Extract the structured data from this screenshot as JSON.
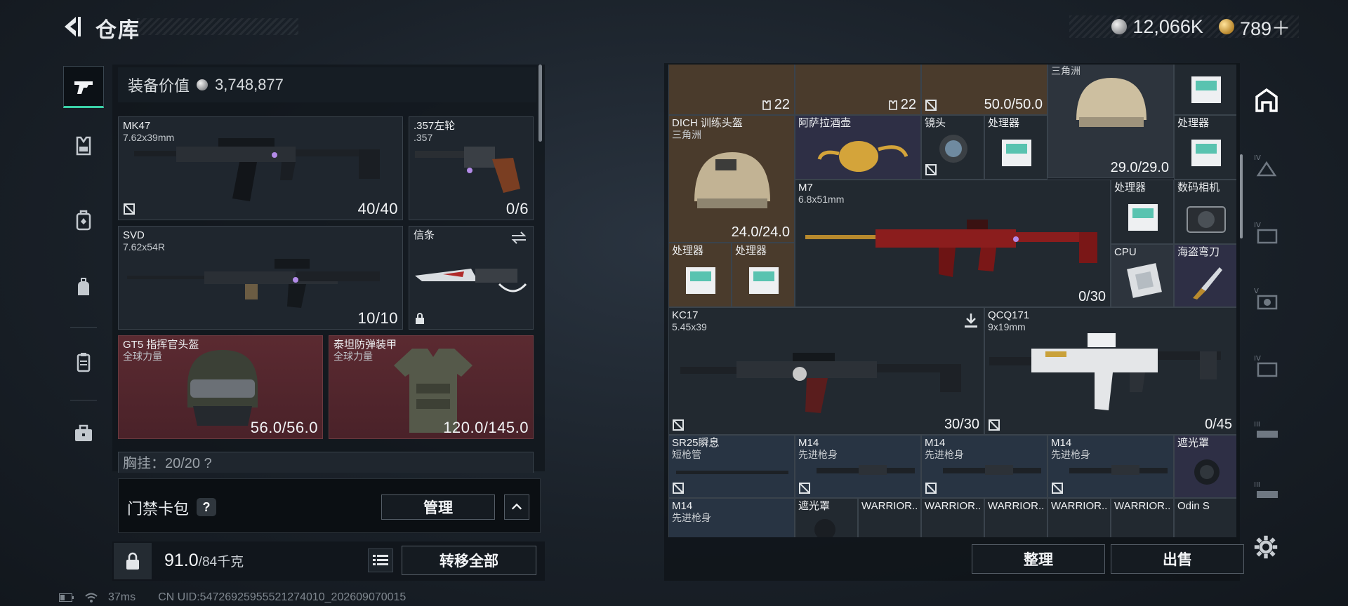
{
  "header": {
    "title": "仓库"
  },
  "currency": {
    "silver": "12,066K",
    "gold": "789＋"
  },
  "equipment": {
    "value_label": "装备价值",
    "value": "3,748,877",
    "slots": [
      {
        "name": "MK47",
        "caliber": "7.62x39mm",
        "ammo": "40/40"
      },
      {
        "name": ".357左轮",
        "caliber": ".357",
        "ammo": "0/6"
      },
      {
        "name": "SVD",
        "caliber": "7.62x54R",
        "ammo": "10/10"
      },
      {
        "name": "信条"
      },
      {
        "name": "GT5 指挥官头盔",
        "sub": "全球力量",
        "durability": "56.0/56.0"
      },
      {
        "name": "泰坦防弹装甲",
        "sub": "全球力量",
        "durability": "120.0/145.0"
      }
    ],
    "partial_row": "胸挂：20/20 ?"
  },
  "access_card": {
    "label": "门禁卡包",
    "help": "?",
    "manage_button": "管理",
    "collapse_icon": "chevron-up-icon"
  },
  "footer_left": {
    "weight": "91.0",
    "weight_max": "/84千克",
    "transfer_all": "转移全部"
  },
  "status_bar": {
    "ping": "37ms",
    "uid": "CN UID:5472692595552127401­0_202609070015"
  },
  "grid": {
    "row0": {
      "a": "22",
      "b": "22",
      "c": "50.0/50.0",
      "top_label": "三角洲",
      "d": "29.0/29.0"
    },
    "items": {
      "dich_name": "DICH 训练头盔",
      "dich_sub": "三角洲",
      "dich_dur": "24.0/24.0",
      "jug": "阿萨拉酒壶",
      "lens": "镜头",
      "proc": "处理器",
      "m7_name": "M7",
      "m7_cal": "6.8x51mm",
      "m7_ammo": "0/30",
      "camera": "数码相机",
      "cpu": "CPU",
      "knife": "海盗弯刀",
      "kc17_name": "KC17",
      "kc17_cal": "5.45x39",
      "kc17_ammo": "30/30",
      "qcq_name": "QCQ171",
      "qcq_cal": "9x19mm",
      "qcq_ammo": "0/45",
      "sr25_name": "SR25瞬息",
      "sr25_sub": "短枪管",
      "m14": "M14",
      "m14_sub": "先进枪身",
      "shade": "遮光罩",
      "warrior": "WARRIOR..",
      "odin": "Odin S"
    }
  },
  "footer_right": {
    "sort": "整理",
    "sell": "出售"
  }
}
